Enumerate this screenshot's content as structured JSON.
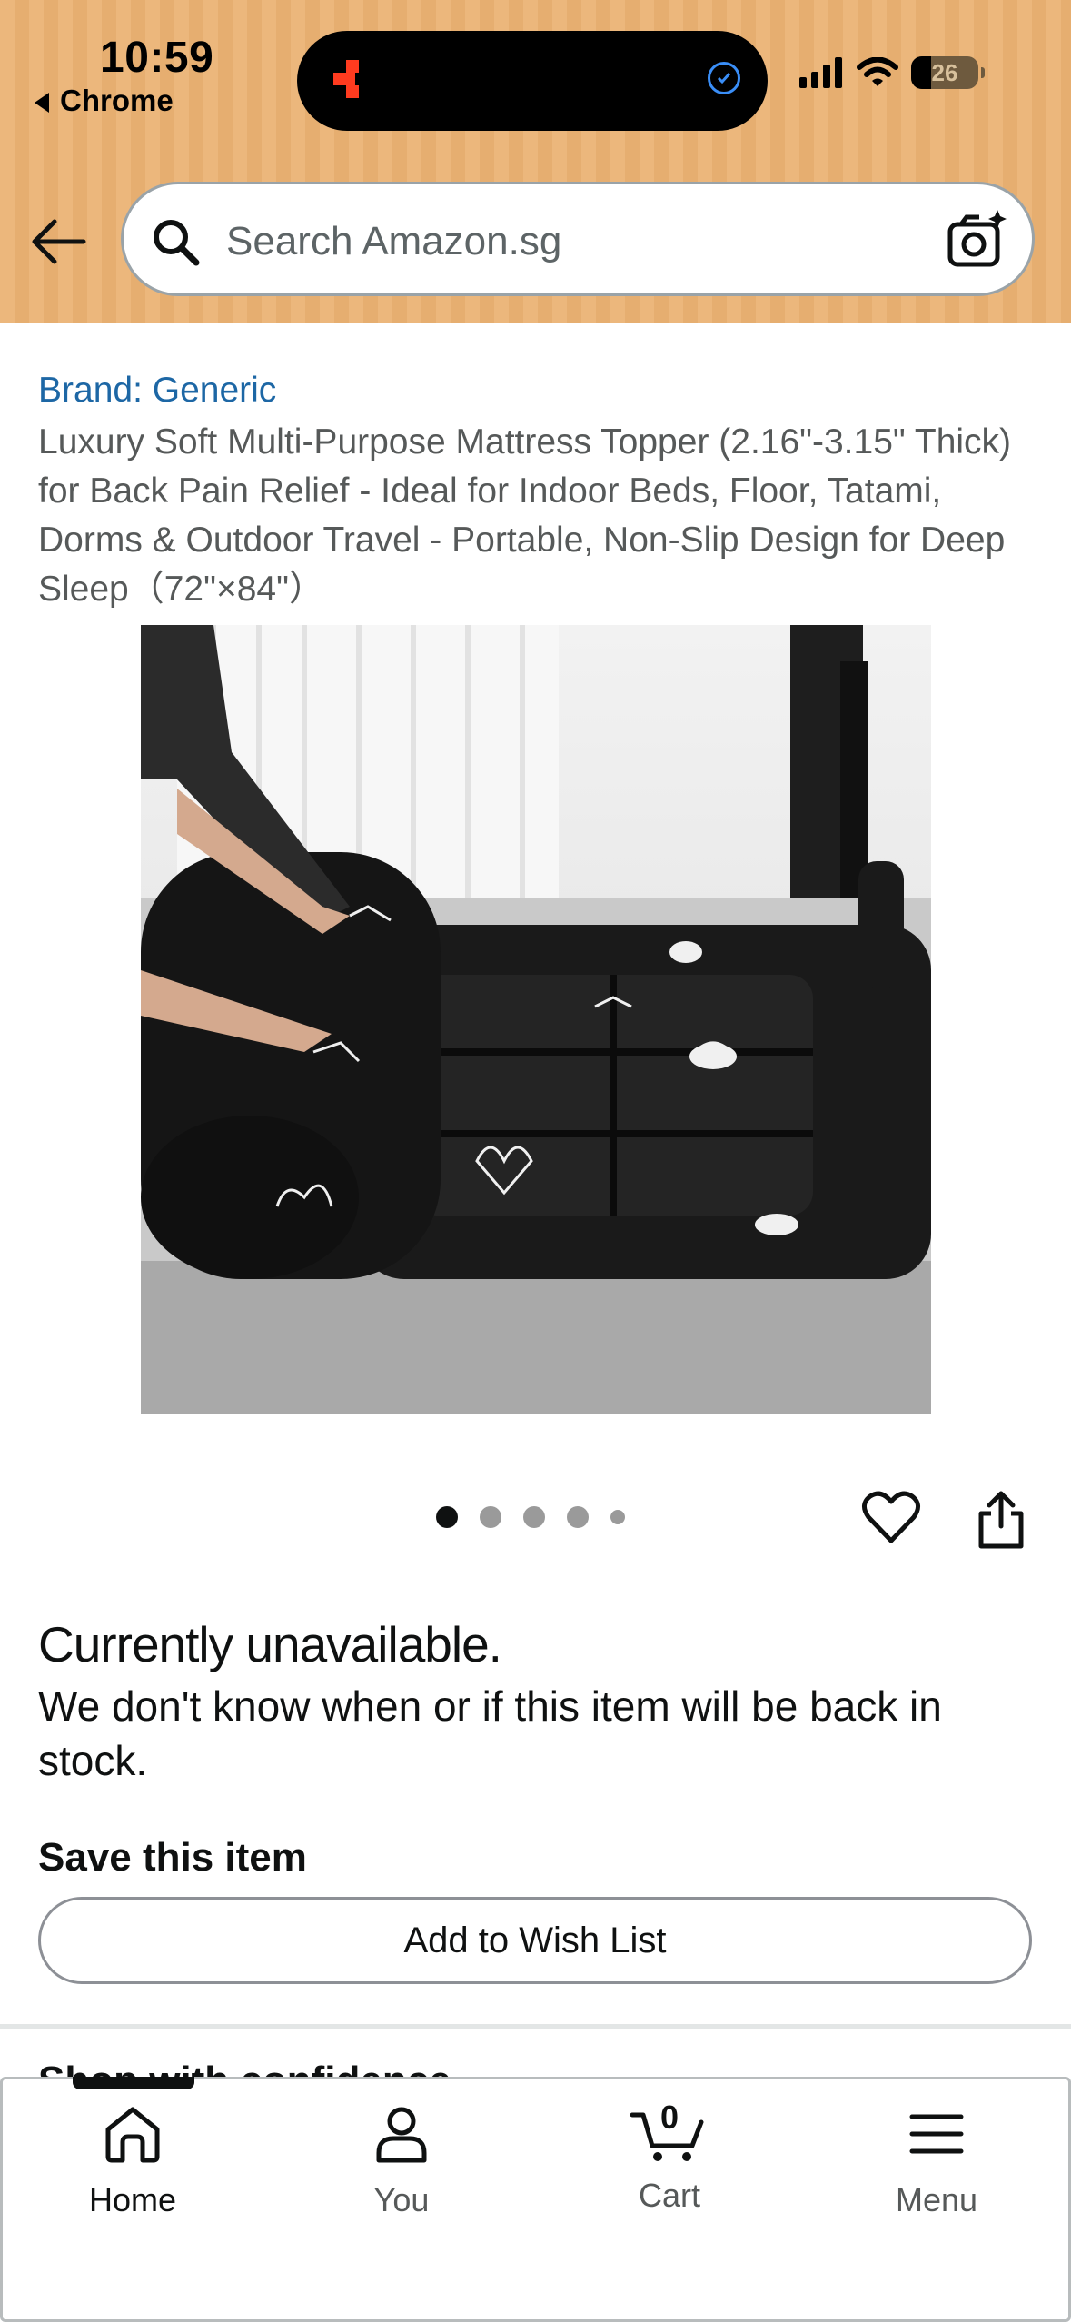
{
  "status_bar": {
    "time": "10:59",
    "back_app": "Chrome",
    "battery": "26"
  },
  "search": {
    "placeholder": "Search Amazon.sg"
  },
  "product": {
    "brand": "Brand: Generic",
    "title": "Luxury Soft Multi-Purpose Mattress Topper (2.16\"-3.15\" Thick) for Back Pain Relief - Ideal for Indoor Beds, Floor, Tatami, Dorms & Outdoor Travel - Portable, Non-Slip Design for Deep Sleep（72\"×84\"）",
    "image_count": 5,
    "active_image": 1
  },
  "availability": {
    "heading": "Currently unavailable.",
    "message": "We don't know when or if this item will be back in stock."
  },
  "save": {
    "heading": "Save this item",
    "wishlist_button": "Add to Wish List"
  },
  "next_section_peek": "Shop with confidence",
  "bottom_nav": {
    "items": [
      {
        "label": "Home",
        "icon": "home-icon"
      },
      {
        "label": "You",
        "icon": "person-icon"
      },
      {
        "label": "Cart",
        "icon": "cart-icon"
      },
      {
        "label": "Menu",
        "icon": "menu-icon"
      }
    ],
    "cart_count": "0",
    "active": "Home"
  },
  "colors": {
    "header_bg": "#ecb77c",
    "link_blue": "#1d67a5",
    "text_dark": "#0f1111",
    "text_gray": "#565959"
  }
}
